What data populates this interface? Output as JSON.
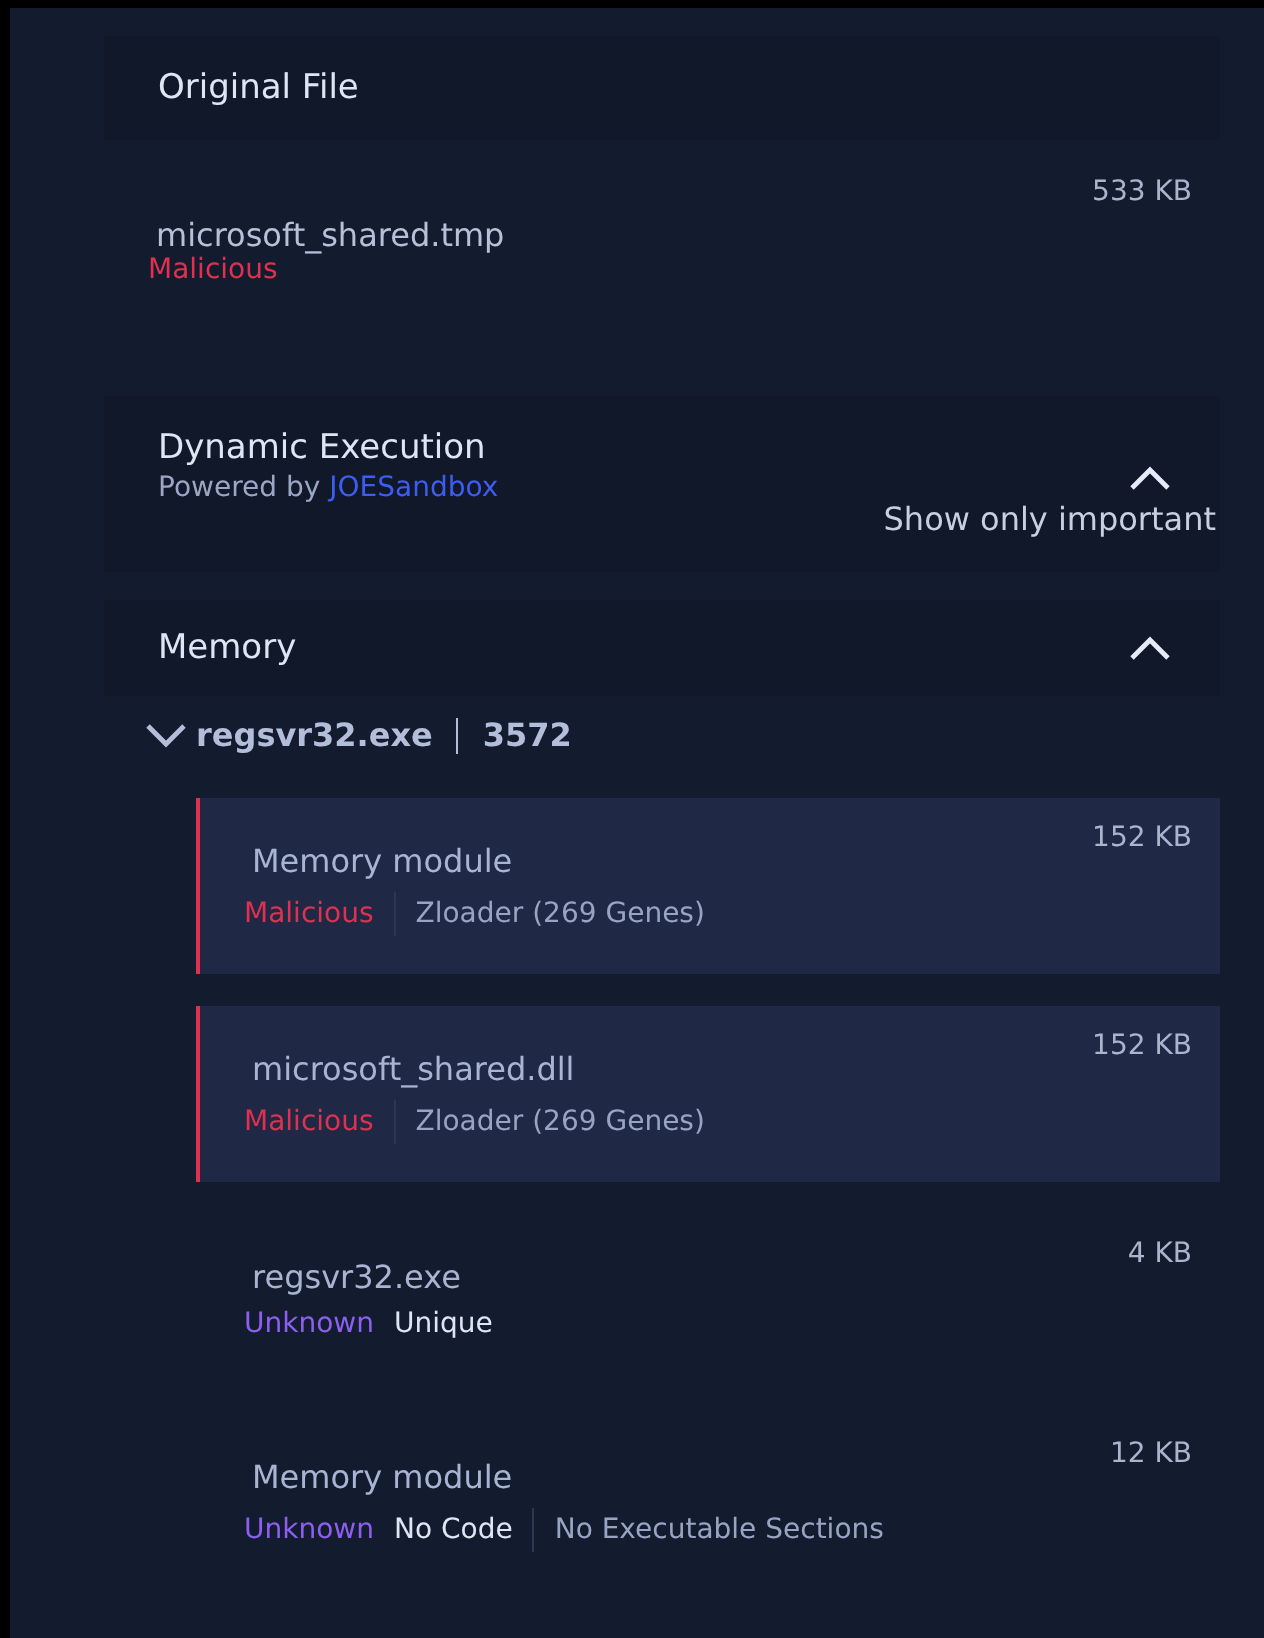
{
  "original_file": {
    "title": "Original File",
    "name": "microsoft_shared.tmp",
    "verdict": {
      "text": "Malicious",
      "kind": "malicious"
    },
    "size": "533 KB"
  },
  "dynamic_execution": {
    "title": "Dynamic Execution",
    "powered_by": "Powered by",
    "provider": "JOESandbox",
    "expanded": true,
    "filter": "Show only important"
  },
  "memory": {
    "title": "Memory",
    "expanded": true,
    "process": {
      "name": "regsvr32.exe",
      "pid": "3572",
      "expanded": true,
      "items": [
        {
          "name": "Memory module",
          "size": "152 KB",
          "verdict": {
            "text": "Malicious",
            "kind": "malicious"
          },
          "tags": [
            {
              "text": "Zloader (269 Genes)",
              "kind": "family"
            }
          ]
        },
        {
          "name": "microsoft_shared.dll",
          "size": "152 KB",
          "verdict": {
            "text": "Malicious",
            "kind": "malicious"
          },
          "tags": [
            {
              "text": "Zloader (269 Genes)",
              "kind": "family"
            }
          ]
        },
        {
          "name": "regsvr32.exe",
          "size": "4 KB",
          "verdict": {
            "text": "Unknown",
            "kind": "unknown"
          },
          "tags": [
            {
              "text": "Unique",
              "kind": "trait"
            }
          ]
        },
        {
          "name": "Memory module",
          "size": "12 KB",
          "verdict": {
            "text": "Unknown",
            "kind": "unknown"
          },
          "tags": [
            {
              "text": "No Code",
              "kind": "trait"
            },
            {
              "text": "No Executable Sections",
              "kind": "family"
            }
          ]
        }
      ]
    }
  }
}
